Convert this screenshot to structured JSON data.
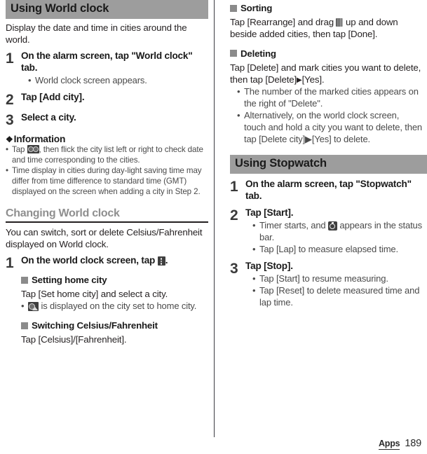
{
  "document": {
    "footer": {
      "label": "Apps",
      "page_number": "189"
    }
  },
  "left_column": {
    "section_title": "Using World clock",
    "intro": "Display the date and time in cities around the world.",
    "steps": [
      {
        "number": "1",
        "title": "On the alarm screen, tap \"World clock\" tab.",
        "bullets": [
          "World clock screen appears."
        ]
      },
      {
        "number": "2",
        "title": "Tap [Add city].",
        "bullets": []
      },
      {
        "number": "3",
        "title": "Select a city.",
        "bullets": []
      }
    ],
    "information": {
      "heading": "Information",
      "bullets": [
        {
          "before_icon": "Tap ",
          "icon": "world-clock-icon",
          "after_icon": ", then flick the city list left or right to check date and time corresponding to the cities."
        },
        {
          "before_icon": "Time display in cities during day-light saving time may differ from time difference to standard time (GMT) displayed on the screen when adding a city in Step 2.",
          "icon": "",
          "after_icon": ""
        }
      ]
    },
    "subsection": {
      "heading": "Changing World clock",
      "intro": "You can switch, sort or delete Celsius/Fahrenheit displayed on World clock.",
      "step": {
        "number": "1",
        "title_before_icon": "On the world clock screen, tap ",
        "title_icon": "overflow-menu-icon",
        "title_after_icon": "."
      },
      "topics": [
        {
          "heading": "Setting home city",
          "body": "Tap [Set home city] and select a city.",
          "bullet_before_icon": "",
          "bullet_icon": "home-city-icon",
          "bullet_after_icon": " is displayed on the city set to home city."
        },
        {
          "heading": "Switching Celsius/Fahrenheit",
          "body": "Tap [Celsius]/[Fahrenheit].",
          "bullet_before_icon": "",
          "bullet_icon": "",
          "bullet_after_icon": ""
        }
      ]
    }
  },
  "right_column": {
    "topics": [
      {
        "heading": "Sorting",
        "body_before_icon": "Tap [Rearrange] and drag ",
        "body_icon": "drag-handle-icon",
        "body_after_icon": " up and down beside added cities, then tap [Done]."
      },
      {
        "heading": "Deleting",
        "body_before_icon": "Tap [Delete] and mark cities you want to delete, then tap [Delete]",
        "body_arrow": "▶",
        "body_after_icon": "[Yes].",
        "bullets": [
          "The number of the marked cities appears on the right of \"Delete\".",
          "Alternatively, on the world clock screen, touch and hold a city you want to delete, then tap [Delete city]▶[Yes] to delete."
        ]
      }
    ],
    "section_title": "Using Stopwatch",
    "steps": [
      {
        "number": "1",
        "title": "On the alarm screen, tap \"Stopwatch\" tab.",
        "bullets": []
      },
      {
        "number": "2",
        "title": "Tap [Start].",
        "bullet_icon_line": {
          "before_icon": "Timer starts, and ",
          "icon": "stopwatch-icon",
          "after_icon": " appears in the status bar."
        },
        "bullets": [
          "Tap [Lap] to measure elapsed time."
        ]
      },
      {
        "number": "3",
        "title": "Tap [Stop].",
        "bullets": [
          "Tap [Start] to resume measuring.",
          "Tap [Reset] to delete measured time and lap time."
        ]
      }
    ]
  },
  "colors": {
    "bar_bg": "#9d9d9d",
    "heading_gray": "#8f8f8f",
    "text": "#231f20",
    "bullet_text": "#4a4a4a"
  }
}
